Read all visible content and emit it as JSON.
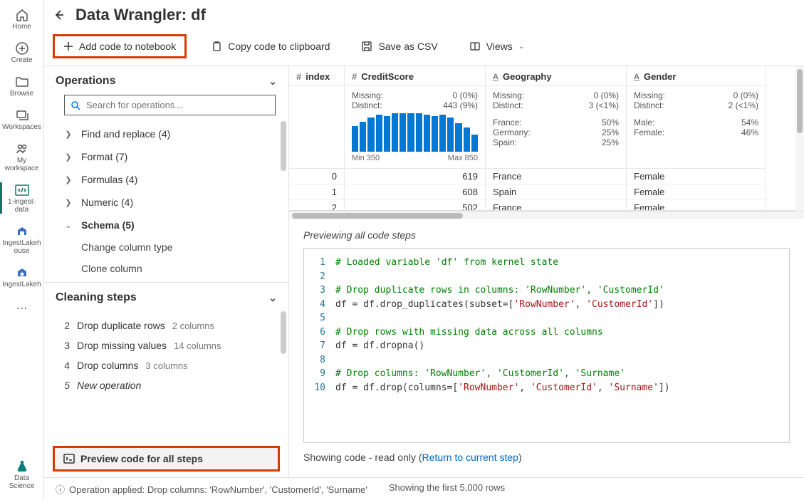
{
  "sidebar": {
    "items": [
      {
        "label": "Home",
        "icon": "home"
      },
      {
        "label": "Create",
        "icon": "plus-circle"
      },
      {
        "label": "Browse",
        "icon": "folder"
      },
      {
        "label": "Workspaces",
        "icon": "stack"
      },
      {
        "label": "My workspace",
        "icon": "people"
      },
      {
        "label": "1-ingest-data",
        "icon": "code-block",
        "active": true
      },
      {
        "label": "IngestLakehouse",
        "icon": "lakehouse"
      },
      {
        "label": "IngestLakeh",
        "icon": "lakehouse-alt"
      }
    ],
    "footer": {
      "label": "Data Science",
      "icon": "flask"
    }
  },
  "header": {
    "title": "Data Wrangler: df"
  },
  "toolbar": {
    "add_code": "Add code to notebook",
    "copy_code": "Copy code to clipboard",
    "save_csv": "Save as CSV",
    "views": "Views"
  },
  "operations": {
    "title": "Operations",
    "search_placeholder": "Search for operations...",
    "groups": [
      {
        "label": "Find and replace (4)"
      },
      {
        "label": "Format (7)"
      },
      {
        "label": "Formulas (4)"
      },
      {
        "label": "Numeric (4)"
      },
      {
        "label": "Schema (5)",
        "expanded": true
      }
    ],
    "schema_items": [
      "Change column type",
      "Clone column"
    ]
  },
  "steps": {
    "title": "Cleaning steps",
    "items": [
      {
        "num": "2",
        "label": "Drop duplicate rows",
        "detail": "2 columns"
      },
      {
        "num": "3",
        "label": "Drop missing values",
        "detail": "14 columns"
      },
      {
        "num": "4",
        "label": "Drop columns",
        "detail": "3 columns"
      },
      {
        "num": "5",
        "label": "New operation",
        "italic": true
      }
    ],
    "preview_all": "Preview code for all steps"
  },
  "columns": {
    "index": {
      "name": "index",
      "type_icon": "#",
      "rows": [
        "0",
        "1",
        "2"
      ]
    },
    "credit": {
      "name": "CreditScore",
      "type_icon": "#",
      "missing_label": "Missing:",
      "missing_val": "0 (0%)",
      "distinct_label": "Distinct:",
      "distinct_val": "443 (9%)",
      "hist_min": "Min 350",
      "hist_max": "Max 850",
      "hist_bars": [
        36,
        42,
        48,
        52,
        50,
        54,
        54,
        54,
        54,
        52,
        50,
        52,
        48,
        40,
        34,
        24
      ],
      "rows": [
        "619",
        "608",
        "502"
      ]
    },
    "geo": {
      "name": "Geography",
      "type_icon": "A",
      "missing_label": "Missing:",
      "missing_val": "0 (0%)",
      "distinct_label": "Distinct:",
      "distinct_val": "3 (<1%)",
      "cats": [
        {
          "k": "France:",
          "v": "50%"
        },
        {
          "k": "Germany:",
          "v": "25%"
        },
        {
          "k": "Spain:",
          "v": "25%"
        }
      ],
      "rows": [
        "France",
        "Spain",
        "France"
      ]
    },
    "gender": {
      "name": "Gender",
      "type_icon": "A",
      "missing_label": "Missing:",
      "missing_val": "0 (0%)",
      "distinct_label": "Distinct:",
      "distinct_val": "2 (<1%)",
      "cats": [
        {
          "k": "Male:",
          "v": "54%"
        },
        {
          "k": "Female:",
          "v": "46%"
        }
      ],
      "rows": [
        "Female",
        "Female",
        "Female"
      ]
    }
  },
  "code": {
    "heading": "Previewing all code steps",
    "lines": [
      {
        "n": "1",
        "segs": [
          {
            "t": "# Loaded variable 'df' from kernel state",
            "c": "cm-comment"
          }
        ]
      },
      {
        "n": "2",
        "segs": []
      },
      {
        "n": "3",
        "segs": [
          {
            "t": "# Drop duplicate rows in columns: 'RowNumber', 'CustomerId'",
            "c": "cm-comment"
          }
        ]
      },
      {
        "n": "4",
        "segs": [
          {
            "t": "df = df.drop_duplicates(subset=["
          },
          {
            "t": "'RowNumber'",
            "c": "cm-str"
          },
          {
            "t": ", "
          },
          {
            "t": "'CustomerId'",
            "c": "cm-str"
          },
          {
            "t": "])"
          }
        ]
      },
      {
        "n": "5",
        "segs": []
      },
      {
        "n": "6",
        "segs": [
          {
            "t": "# Drop rows with missing data across all columns",
            "c": "cm-comment"
          }
        ]
      },
      {
        "n": "7",
        "segs": [
          {
            "t": "df = df.dropna()"
          }
        ]
      },
      {
        "n": "8",
        "segs": []
      },
      {
        "n": "9",
        "segs": [
          {
            "t": "# Drop columns: 'RowNumber', 'CustomerId', 'Surname'",
            "c": "cm-comment"
          }
        ]
      },
      {
        "n": "10",
        "segs": [
          {
            "t": "df = df.drop(columns=["
          },
          {
            "t": "'RowNumber'",
            "c": "cm-str"
          },
          {
            "t": ", "
          },
          {
            "t": "'CustomerId'",
            "c": "cm-str"
          },
          {
            "t": ", "
          },
          {
            "t": "'Surname'",
            "c": "cm-str"
          },
          {
            "t": "])"
          }
        ]
      }
    ],
    "status_prefix": "Showing code - read only (",
    "status_link": "Return to current step",
    "status_suffix": ")"
  },
  "statusbar": {
    "msg1": "Operation applied: Drop columns: 'RowNumber', 'CustomerId', 'Surname'",
    "msg2": "Showing the first 5,000 rows"
  }
}
